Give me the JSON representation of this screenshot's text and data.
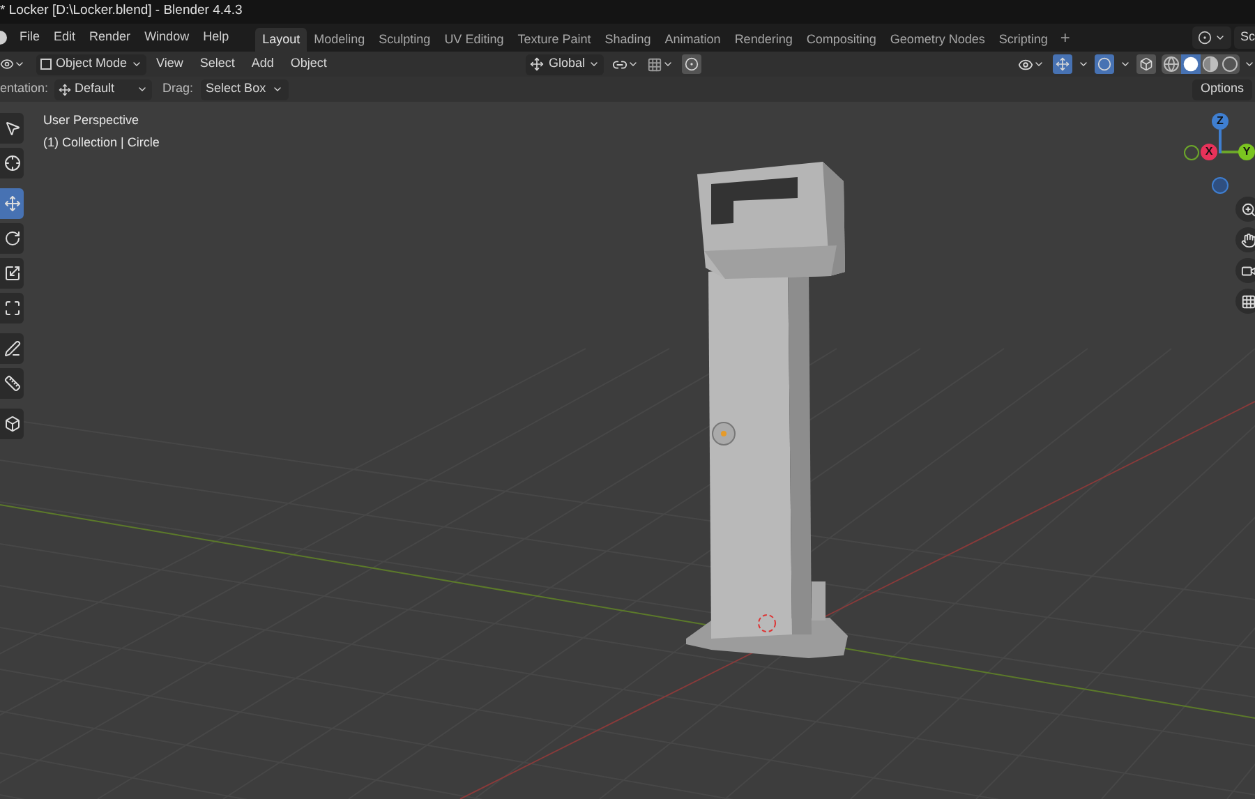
{
  "window": {
    "title": "* Locker [D:\\Locker.blend] - Blender 4.4.3"
  },
  "menu": [
    "File",
    "Edit",
    "Render",
    "Window",
    "Help"
  ],
  "workspaces": [
    {
      "label": "Layout",
      "selected": true
    },
    {
      "label": "Modeling",
      "selected": false
    },
    {
      "label": "Sculpting",
      "selected": false
    },
    {
      "label": "UV Editing",
      "selected": false
    },
    {
      "label": "Texture Paint",
      "selected": false
    },
    {
      "label": "Shading",
      "selected": false
    },
    {
      "label": "Animation",
      "selected": false
    },
    {
      "label": "Rendering",
      "selected": false
    },
    {
      "label": "Compositing",
      "selected": false
    },
    {
      "label": "Geometry Nodes",
      "selected": false
    },
    {
      "label": "Scripting",
      "selected": false
    }
  ],
  "add_workspace": "+",
  "scene_label": "Sc",
  "header": {
    "mode": "Object Mode",
    "menus": [
      "View",
      "Select",
      "Add",
      "Object"
    ],
    "transform_orientation": "Global",
    "overlays_on": true,
    "gizmos_on": true,
    "shading_modes": [
      {
        "kind": "wireframe",
        "selected": false
      },
      {
        "kind": "solid",
        "selected": true
      },
      {
        "kind": "material",
        "selected": false
      },
      {
        "kind": "rendered",
        "selected": false
      }
    ]
  },
  "tool_settings": {
    "orientation_label": "entation:",
    "orientation": "Default",
    "drag_label": "Drag:",
    "drag": "Select Box",
    "options": "Options"
  },
  "toolbar": [
    {
      "kind": "select",
      "selected": false
    },
    {
      "kind": "cursor",
      "selected": false
    },
    {
      "kind": "move",
      "selected": true
    },
    {
      "kind": "rotate",
      "selected": false
    },
    {
      "kind": "scale",
      "selected": false
    },
    {
      "kind": "transform",
      "selected": false
    },
    {
      "kind": "annotate",
      "selected": false
    },
    {
      "kind": "measure",
      "selected": false
    },
    {
      "kind": "add-cube",
      "selected": false
    }
  ],
  "viewport": {
    "view_name": "User Perspective",
    "collection_info": "(1) Collection | Circle",
    "gizmo": {
      "x": "X",
      "y": "Y",
      "z": "Z"
    }
  }
}
